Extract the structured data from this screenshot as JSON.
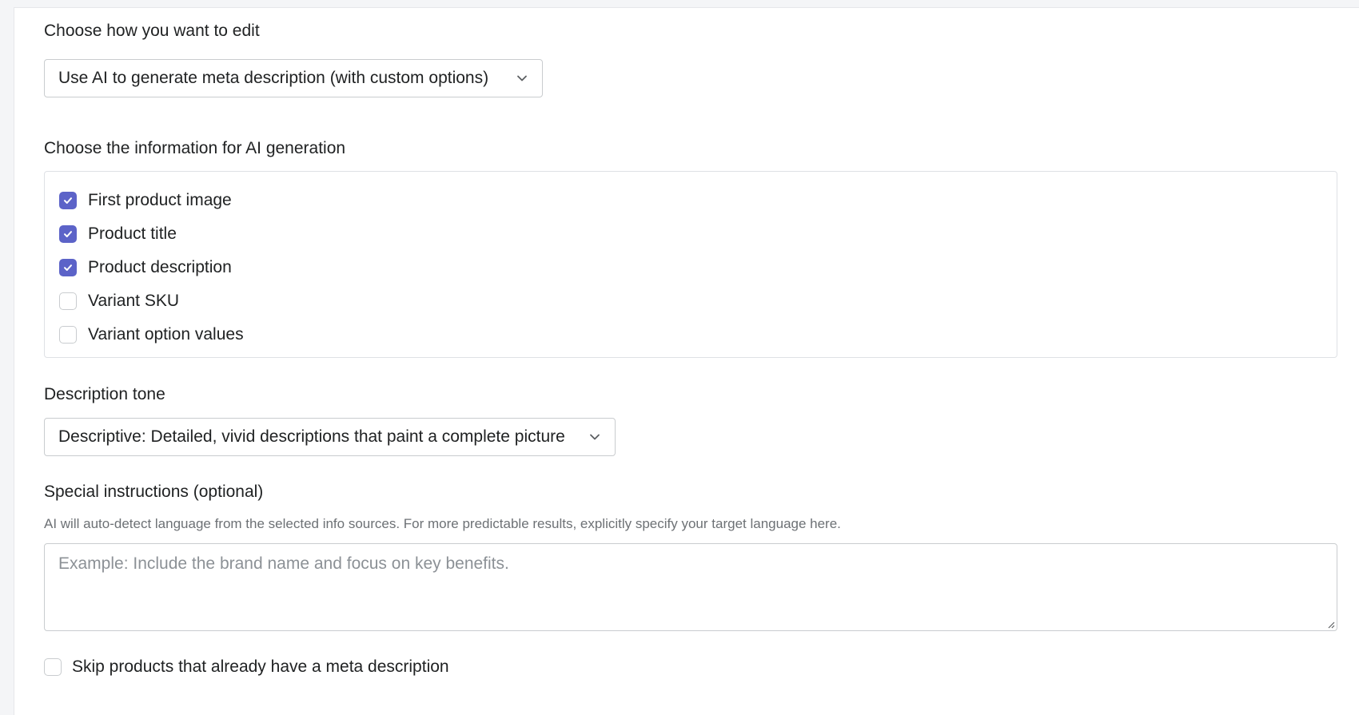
{
  "edit_mode": {
    "label": "Choose how you want to edit",
    "selected": "Use AI to generate meta description (with custom options)"
  },
  "ai_info": {
    "label": "Choose the information for AI generation",
    "options": [
      {
        "label": "First product image",
        "checked": true
      },
      {
        "label": "Product title",
        "checked": true
      },
      {
        "label": "Product description",
        "checked": true
      },
      {
        "label": "Variant SKU",
        "checked": false
      },
      {
        "label": "Variant option values",
        "checked": false
      }
    ]
  },
  "tone": {
    "label": "Description tone",
    "selected": "Descriptive: Detailed, vivid descriptions that paint a complete picture"
  },
  "instructions": {
    "label": "Special instructions (optional)",
    "help": "AI will auto-detect language from the selected info sources. For more predictable results, explicitly specify your target language here.",
    "placeholder": "Example: Include the brand name and focus on key benefits.",
    "value": ""
  },
  "skip": {
    "label": "Skip products that already have a meta description",
    "checked": false
  },
  "colors": {
    "accent": "#5c63c8",
    "border": "#c9cccf",
    "text": "#202223",
    "subdued": "#6d7175"
  },
  "icons": {
    "select_chevron": "chevron-down-icon",
    "checkmark": "checkmark-icon",
    "resize": "resize-handle-icon"
  }
}
